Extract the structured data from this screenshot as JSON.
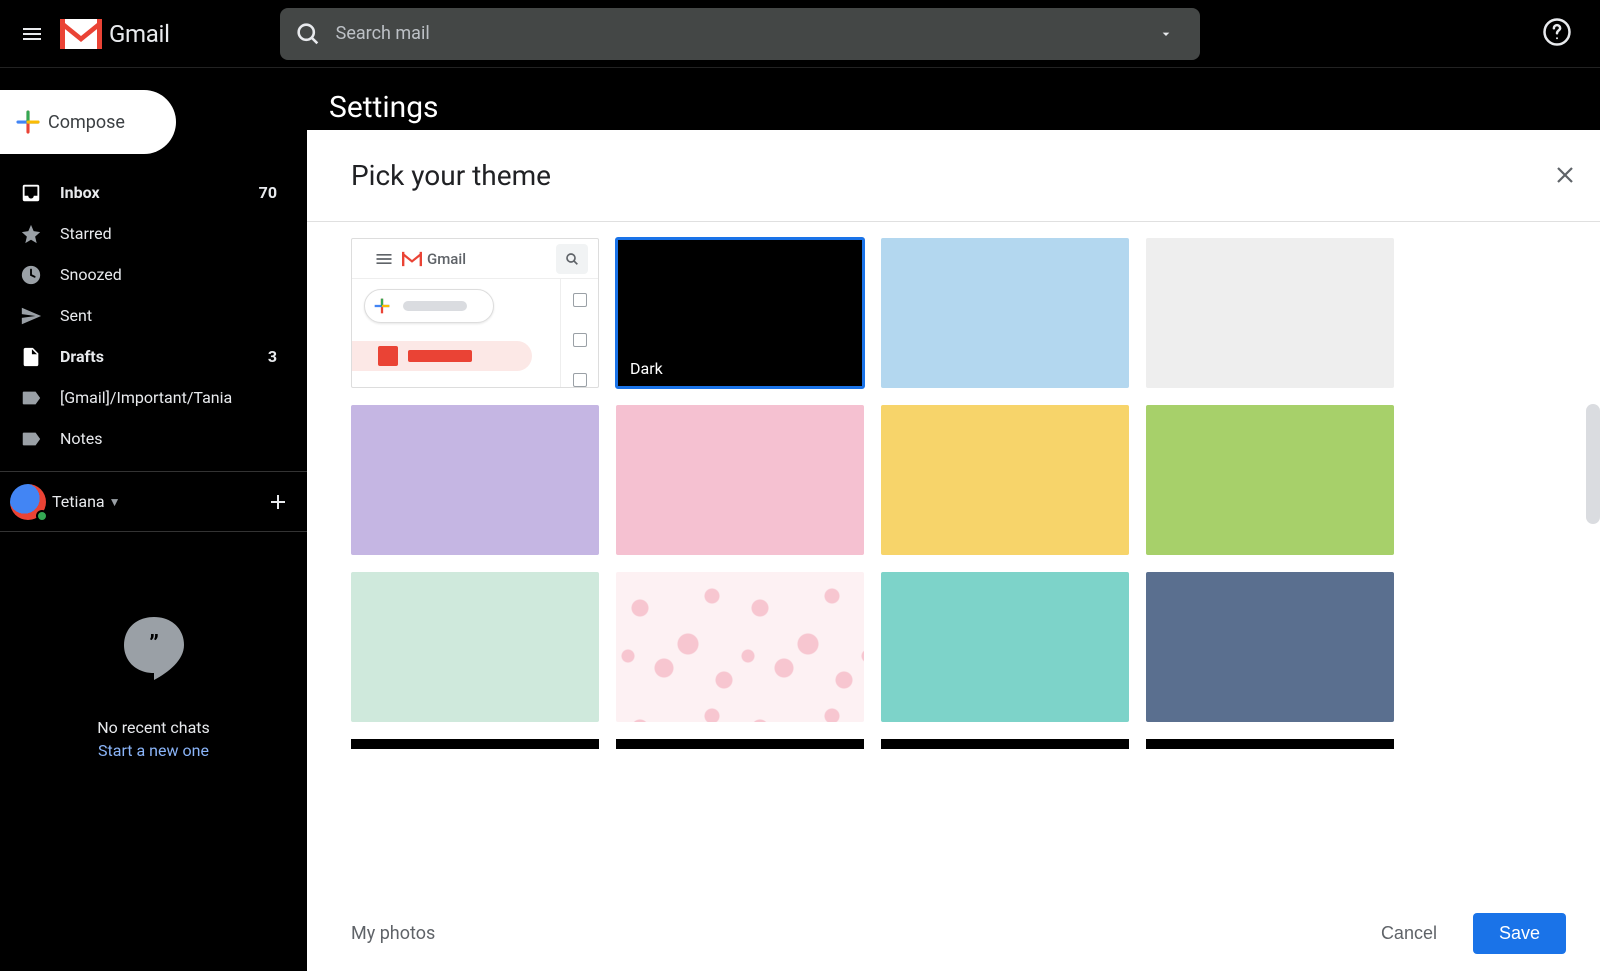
{
  "header": {
    "app_name": "Gmail",
    "search_placeholder": "Search mail"
  },
  "sidebar": {
    "compose_label": "Compose",
    "items": [
      {
        "icon": "inbox",
        "label": "Inbox",
        "count": "70",
        "bold": true
      },
      {
        "icon": "star",
        "label": "Starred",
        "count": "",
        "bold": false
      },
      {
        "icon": "clock",
        "label": "Snoozed",
        "count": "",
        "bold": false
      },
      {
        "icon": "send",
        "label": "Sent",
        "count": "",
        "bold": false
      },
      {
        "icon": "file",
        "label": "Drafts",
        "count": "3",
        "bold": true
      },
      {
        "icon": "label",
        "label": "[Gmail]/Important/Tania",
        "count": "",
        "bold": false
      },
      {
        "icon": "label",
        "label": "Notes",
        "count": "",
        "bold": false
      }
    ]
  },
  "hangouts": {
    "name": "Tetiana",
    "no_recent": "No recent chats",
    "start_new": "Start a new one"
  },
  "main": {
    "settings_title": "Settings",
    "preview_app_name": "Gmail"
  },
  "dialog": {
    "title": "Pick your theme",
    "selected_label": "Dark",
    "themes": [
      {
        "type": "default",
        "color": "",
        "label": "",
        "selected": false
      },
      {
        "type": "solid",
        "color": "#000000",
        "label": "Dark",
        "selected": true
      },
      {
        "type": "solid",
        "color": "#b3d7ef",
        "label": "",
        "selected": false
      },
      {
        "type": "solid",
        "color": "#eeeeee",
        "label": "",
        "selected": false
      },
      {
        "type": "solid",
        "color": "#c5b6e3",
        "label": "",
        "selected": false
      },
      {
        "type": "solid",
        "color": "#f5c1d1",
        "label": "",
        "selected": false
      },
      {
        "type": "solid",
        "color": "#f7d46a",
        "label": "",
        "selected": false
      },
      {
        "type": "solid",
        "color": "#a7d06a",
        "label": "",
        "selected": false
      },
      {
        "type": "solid",
        "color": "#cfe9dc",
        "label": "",
        "selected": false
      },
      {
        "type": "pattern",
        "color": "cherry",
        "label": "",
        "selected": false
      },
      {
        "type": "solid",
        "color": "#7dd3c9",
        "label": "",
        "selected": false
      },
      {
        "type": "solid",
        "color": "#5a6f8f",
        "label": "",
        "selected": false
      }
    ],
    "my_photos": "My photos",
    "cancel": "Cancel",
    "save": "Save"
  }
}
